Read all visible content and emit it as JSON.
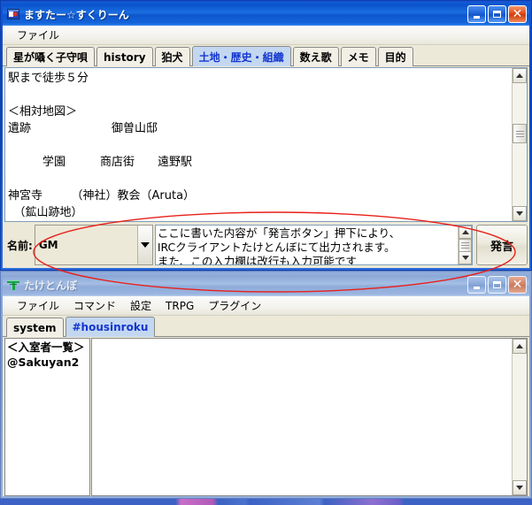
{
  "windows": {
    "master_screen": {
      "title": "ますたー☆すくりーん",
      "icon_name": "app-icon-master-screen",
      "menus": [
        "ファイル"
      ],
      "tabs": [
        {
          "label": "星が囁く子守唄",
          "selected": false
        },
        {
          "label": "history",
          "selected": false
        },
        {
          "label": "狛犬",
          "selected": false
        },
        {
          "label": "土地・歴史・組織",
          "selected": true
        },
        {
          "label": "数え歌",
          "selected": false
        },
        {
          "label": "メモ",
          "selected": false
        },
        {
          "label": "目的",
          "selected": false
        }
      ],
      "document_text": "駅まで徒歩５分\n\n＜相対地図＞\n遺跡　　　　　　　御曽山邸\n\n　　　学園　　　商店街　　遠野駅\n\n神宮寺　　　（神社）教会（Aruta）\n　（鉱山跡地）\n",
      "name_label": "名前:",
      "name_value": "GM",
      "message_value": "ここに書いた内容が「発言ボタン」押下により、\nIRCクライアントたけとんぼにて出力されます。\nまた、この入力欄は改行も入力可能です",
      "send_button": "発言",
      "caption": {
        "minimize": "_",
        "maximize": "□",
        "close": "✕"
      }
    },
    "takedonbo": {
      "title": "たけとんぼ",
      "icon_name": "app-icon-takedonbo",
      "menus": [
        "ファイル",
        "コマンド",
        "設定",
        "TRPG",
        "プラグイン"
      ],
      "tabs": [
        {
          "label": "system",
          "selected": false
        },
        {
          "label": "#housinroku",
          "selected": true
        }
      ],
      "userlist_header": "＜入室者一覧＞",
      "userlist_entries": [
        "@Sakuyan2"
      ],
      "chat_text": "",
      "caption": {
        "minimize": "_",
        "maximize": "□",
        "close": "✕"
      }
    }
  },
  "annotation": {
    "shape": "ellipse",
    "color": "#e8201a",
    "target": "name-combo-and-message-input-row"
  },
  "colors": {
    "active_title": "#0a52cc",
    "inactive_title": "#8aa7d6",
    "selected_tab_bg": "#c3d8f0",
    "selected_tab_text": "#1335d0",
    "client_bg": "#ece9d8",
    "desktop": "#3b62c4",
    "annotation": "#e8201a"
  }
}
